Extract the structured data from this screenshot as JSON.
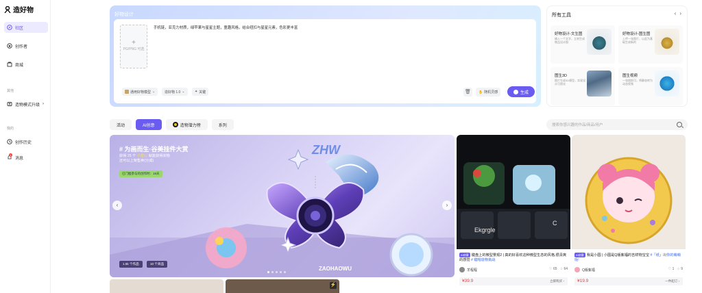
{
  "app": {
    "logo_text": "造好物"
  },
  "sidebar": {
    "items": [
      {
        "label": "社区",
        "icon": "compass-icon",
        "active": true
      },
      {
        "label": "创作者",
        "icon": "star-icon"
      },
      {
        "label": "商城",
        "icon": "shop-icon"
      }
    ],
    "group_other": "其他",
    "upgrade": {
      "label": "造物模式升级",
      "arrow": "›"
    },
    "group_mine": "我的",
    "history": "创作历史",
    "messages": {
      "label": "消息",
      "badge": "1"
    }
  },
  "editor": {
    "title": "好物设计",
    "upload_label": "PG/PNG 可选",
    "upload_plus": "+",
    "prompt": "手机链，亚克力材质，绿苹果与星星主题，童趣风格，结合纽扣与星星元素，色彩更丰富",
    "model_chip": "通用好物模型",
    "version_chip": "造好物 1.0",
    "fx_chip": "关键",
    "random_label": "随机灵感",
    "generate_label": "生成"
  },
  "tools": {
    "title": "所有工具",
    "prev": "‹",
    "next": "›",
    "items": [
      {
        "name": "好物设计-文生图",
        "desc": "输入一个文字，立刻生成物品设计图"
      },
      {
        "name": "好物设计-图生图",
        "desc": "上传一张图片，以此为基础生成新的"
      },
      {
        "name": "图生3D",
        "desc": "图片生成3D模型，实现设计可视化"
      },
      {
        "name": "图生视频",
        "desc": "一张图即可，将静态转为动态视频"
      }
    ]
  },
  "tabs": [
    {
      "label": "活动",
      "active": false
    },
    {
      "label": "AI创意",
      "active": true
    },
    {
      "label": "造物潜力榜",
      "active": false,
      "icon": "medal-icon"
    },
    {
      "label": "系列",
      "active": false
    }
  ],
  "search": {
    "placeholder": "搜索你感兴趣的作品/商品/用户"
  },
  "banner": {
    "title": "# 为画而生·谷美挂件大赏",
    "sub_line1_a": "获得 25 个 ",
    "sub_line1_b": "小爱心",
    "sub_line1_c": " 就能获得实物",
    "sub_line2": "还可以上架售卖(分成)",
    "pill": "已门槛参与的创作时：18天",
    "stat_works": "1.5k 个作品",
    "stat_goods": "10 个商品",
    "prev": "‹",
    "next": "›",
    "brand": "ZHW",
    "brand_bottom": "ZAOHAOWU"
  },
  "products": [
    {
      "tag": "AI创意",
      "title": "键盘上的微型景观2 | 真的好喜欢这种微型生态的风格,很清爽的感觉 ",
      "link": "# 键帽造物挑战",
      "author": "羊程程",
      "likes": "65",
      "favs": "64",
      "price": "¥39.9",
      "buy": "立即购买 ›"
    },
    {
      "tag": "AI创意",
      "title": "我是小圆 | 小圆是Q版紫福的吉祥物宝宝 ",
      "link": "#「纸」出你的萌萌哒!",
      "author": "Q版紫福",
      "likes": "1",
      "favs": "9",
      "price": "¥19.9",
      "buy": "一件起订 ›"
    }
  ],
  "colors": {
    "accent": "#6a5cf0",
    "price": "#e84545",
    "link": "#3b6cf0"
  }
}
